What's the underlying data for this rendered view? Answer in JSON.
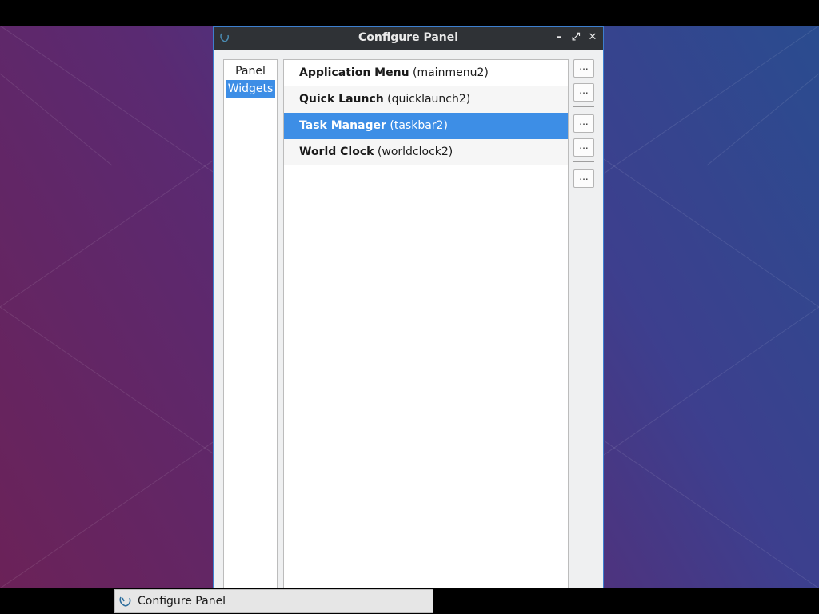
{
  "window": {
    "title": "Configure Panel",
    "minimize_glyph": "–",
    "maximize_glyph": "⤢",
    "close_glyph": "✕"
  },
  "categories": [
    {
      "label": "Panel",
      "selected": false
    },
    {
      "label": "Widgets",
      "selected": true
    }
  ],
  "plugins": [
    {
      "name": "Application Menu",
      "id": "(mainmenu2)",
      "selected": false
    },
    {
      "name": "Quick Launch",
      "id": "(quicklaunch2)",
      "selected": false
    },
    {
      "name": "Task Manager",
      "id": "(taskbar2)",
      "selected": true
    },
    {
      "name": "World Clock",
      "id": "(worldclock2)",
      "selected": false
    }
  ],
  "side_buttons": [
    "...",
    "...",
    "...",
    "...",
    "..."
  ],
  "taskbar": {
    "item_label": "Configure Panel",
    "icon": "lxqt-config-icon"
  },
  "colors": {
    "selection": "#3d8ee6",
    "titlebar": "#2f3236",
    "window_border": "#3d7fcf"
  }
}
